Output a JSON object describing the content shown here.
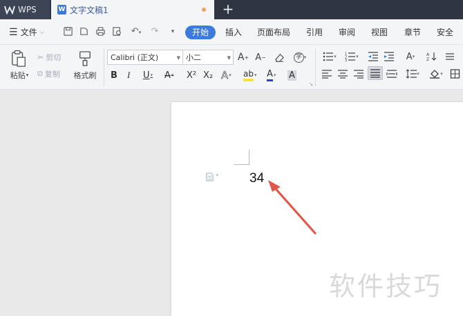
{
  "tabbar": {
    "app_label": "WPS",
    "doc_tab_title": "文字文稿1",
    "new_tab_symbol": "+"
  },
  "menubar": {
    "file_label": "文件",
    "tabs": [
      "开始",
      "插入",
      "页面布局",
      "引用",
      "审阅",
      "视图",
      "章节",
      "安全"
    ],
    "active_tab": "开始"
  },
  "ribbon": {
    "paste_label": "粘贴",
    "cut_label": "剪切",
    "copy_label": "复制",
    "format_painter_label": "格式刷",
    "font_name": "Calibri (正文)",
    "font_size": "小二",
    "superscript": "X²",
    "subscript": "X₂"
  },
  "document": {
    "text": "34"
  },
  "watermark": "软件技巧",
  "colors": {
    "accent": "#3d7ae0",
    "tabbar_bg": "#2f3541",
    "arrow": "#e0574a",
    "highlight": "#f5e33a",
    "font_color": "#2b3fd1"
  }
}
